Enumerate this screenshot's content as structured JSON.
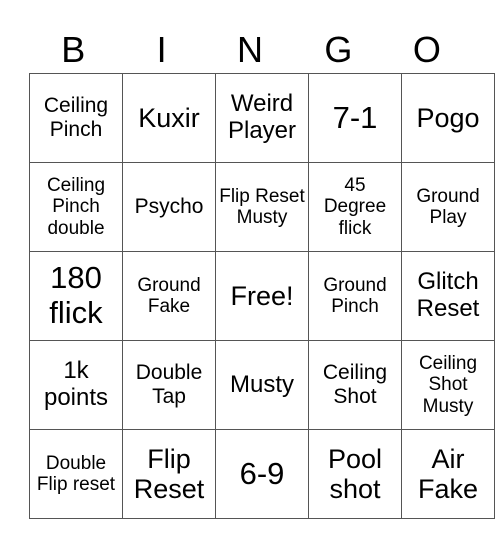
{
  "header": [
    "B",
    "I",
    "N",
    "G",
    "O"
  ],
  "rows": [
    [
      "Ceiling Pinch",
      "Kuxir",
      "Weird Player",
      "7-1",
      "Pogo"
    ],
    [
      "Ceiling Pinch double",
      "Psycho",
      "Flip Reset Musty",
      "45 Degree flick",
      "Ground Play"
    ],
    [
      "180 flick",
      "Ground Fake",
      "Free!",
      "Ground Pinch",
      "Glitch Reset"
    ],
    [
      "1k points",
      "Double Tap",
      "Musty",
      "Ceiling Shot",
      "Ceiling Shot Musty"
    ],
    [
      "Double Flip reset",
      "Flip Reset",
      "6-9",
      "Pool shot",
      "Air Fake"
    ]
  ],
  "free_space": "Free!"
}
